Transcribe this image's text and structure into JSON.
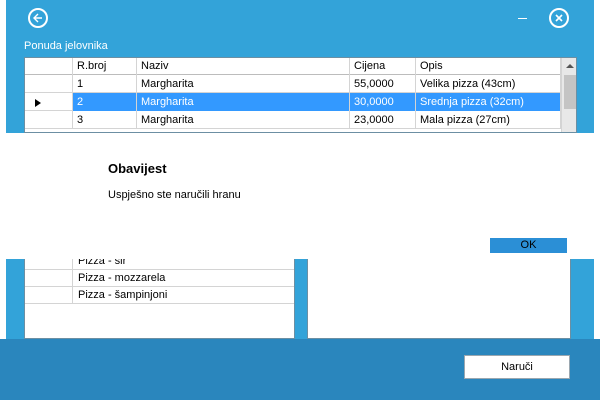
{
  "window": {
    "title": "Ponuda jelovnika"
  },
  "grid": {
    "columns": [
      "R.broj",
      "Naziv",
      "Cijena",
      "Opis"
    ],
    "rows": [
      {
        "rbroj": "1",
        "naziv": "Margharita",
        "cijena": "55,0000",
        "opis": "Velika pizza (43cm)"
      },
      {
        "rbroj": "2",
        "naziv": "Margharita",
        "cijena": "30,0000",
        "opis": "Srednja pizza (32cm)"
      },
      {
        "rbroj": "3",
        "naziv": "Margharita",
        "cijena": "23,0000",
        "opis": "Mala pizza (27cm)"
      }
    ],
    "selected_row": 2
  },
  "dialog": {
    "title": "Obavijest",
    "message": "Uspješno ste naručili hranu",
    "ok_label": "OK"
  },
  "lower_list": {
    "items": [
      "Pizza - sir",
      "Pizza - mozzarela",
      "Pizza - šampinjoni"
    ]
  },
  "footer": {
    "order_label": "Naruči"
  },
  "colors": {
    "window_bg": "#33a3d9",
    "footer_bg": "#2a86bd",
    "selection": "#3399ff",
    "ok_button": "#2b8fd6"
  },
  "icons": {
    "back": "back-arrow-icon",
    "minimize": "minimize-icon",
    "close": "close-icon",
    "scroll_up": "chevron-up-icon",
    "row_marker": "row-pointer-icon"
  }
}
